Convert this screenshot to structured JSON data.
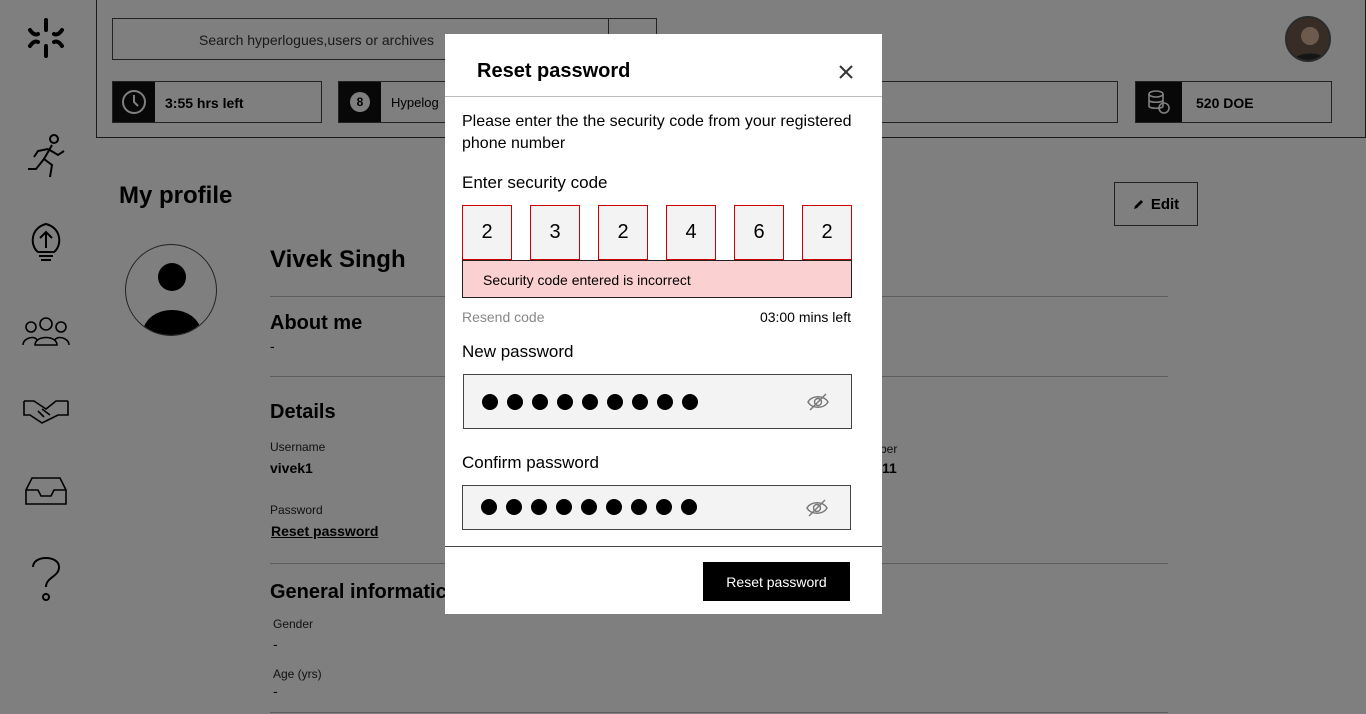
{
  "header": {
    "search_placeholder": "Search hyperlogues,users or archives",
    "chips": [
      {
        "text": "3:55 hrs left",
        "icon": "clock-icon"
      },
      {
        "text": "Hypelog",
        "badge": "8",
        "icon": "badge-icon"
      },
      {
        "text": "520 DOE",
        "icon": "coins-icon"
      }
    ]
  },
  "sidebar": {
    "items": [
      "logo-icon",
      "running-icon",
      "lightbulb-icon",
      "group-icon",
      "handshake-icon",
      "inbox-icon",
      "help-icon"
    ]
  },
  "profile": {
    "title": "My profile",
    "edit_label": "Edit",
    "name": "Vivek Singh",
    "about_heading": "About me",
    "about_value": "-",
    "details_heading": "Details",
    "username_label": "Username",
    "username_value": "vivek1",
    "password_label": "Password",
    "reset_link": "Reset password",
    "phone_label_partial": "ber",
    "phone_value_partial": "11",
    "general_heading": "General informatic",
    "gender_label": "Gender",
    "gender_value": "-",
    "age_label": "Age (yrs)",
    "age_value": "-"
  },
  "modal": {
    "title": "Reset password",
    "instruction": "Please enter the the security code from your registered phone number",
    "code_label": "Enter security code",
    "code_digits": [
      "2",
      "3",
      "2",
      "4",
      "6",
      "2"
    ],
    "error_message": "Security code entered is incorrect",
    "resend_label": "Resend code",
    "timer_text": "03:00 mins left",
    "new_password_label": "New password",
    "confirm_password_label": "Confirm password",
    "submit_label": "Reset password"
  },
  "colors": {
    "error_border": "#cc0000",
    "error_bg": "#fbd0d0",
    "primary_button": "#000000",
    "overlay": "rgba(0,0,0,0.5)"
  }
}
